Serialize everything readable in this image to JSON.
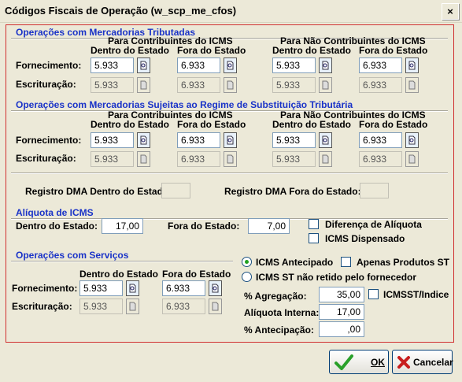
{
  "window": {
    "title": "Códigos Fiscais de Operação (w_scp_me_cfos)",
    "close_glyph": "×"
  },
  "sec1": {
    "title": "Operações com Mercadorias Tributadas",
    "hdr_contrib": "Para Contribuintes do ICMS",
    "hdr_nao": "Para Não Contribuintes do ICMS",
    "col_dentro": "Dentro do Estado",
    "col_fora": "Fora do Estado",
    "fornecimento_label": "Fornecimento:",
    "escrituracao_label": "Escrituração:",
    "forn": [
      "5.933",
      "6.933",
      "5.933",
      "6.933"
    ],
    "escr": [
      "5.933",
      "6.933",
      "5.933",
      "6.933"
    ]
  },
  "sec2": {
    "title": "Operações com Mercadorias Sujeitas ao Regime de Substituição Tributária",
    "hdr_contrib": "Para Contribuintes do ICMS",
    "hdr_nao": "Para Não Contribuintes do ICMS",
    "col_dentro": "Dentro do Estado",
    "col_fora": "Fora do Estado",
    "fornecimento_label": "Fornecimento:",
    "escrituracao_label": "Escrituração:",
    "forn": [
      "5.933",
      "6.933",
      "5.933",
      "6.933"
    ],
    "escr": [
      "5.933",
      "6.933",
      "5.933",
      "6.933"
    ]
  },
  "dma": {
    "dentro_label": "Registro DMA Dentro do Estado:",
    "fora_label": "Registro DMA Fora do Estado:",
    "dentro_value": "",
    "fora_value": ""
  },
  "aliquota": {
    "title": "Alíquota de ICMS",
    "dentro_label": "Dentro do Estado:",
    "dentro_value": "17,00",
    "fora_label": "Fora do Estado:",
    "fora_value": "7,00",
    "diferenca_label": "Diferença de Alíquota",
    "dispensado_label": "ICMS Dispensado"
  },
  "servicos": {
    "title": "Operações com Serviços",
    "col_dentro": "Dentro do Estado",
    "col_fora": "Fora do Estado",
    "fornecimento_label": "Fornecimento:",
    "escrituracao_label": "Escrituração:",
    "forn": [
      "5.933",
      "6.933"
    ],
    "escr": [
      "5.933",
      "6.933"
    ]
  },
  "icms_opts": {
    "antecipado_label": "ICMS Antecipado",
    "st_label": "ICMS ST não retido pelo fornecedor",
    "apenas_st_label": "Apenas Produtos ST",
    "agregacao_label": "% Agregação:",
    "agregacao_value": "35,00",
    "icmsst_label": "ICMSST/Indice",
    "aliq_interna_label": "Alíquota Interna:",
    "aliq_interna_value": "17,00",
    "antecipacao_label": "% Antecipação:",
    "antecipacao_value": ",00"
  },
  "buttons": {
    "ok": "OK",
    "cancel": "Cancelar"
  }
}
